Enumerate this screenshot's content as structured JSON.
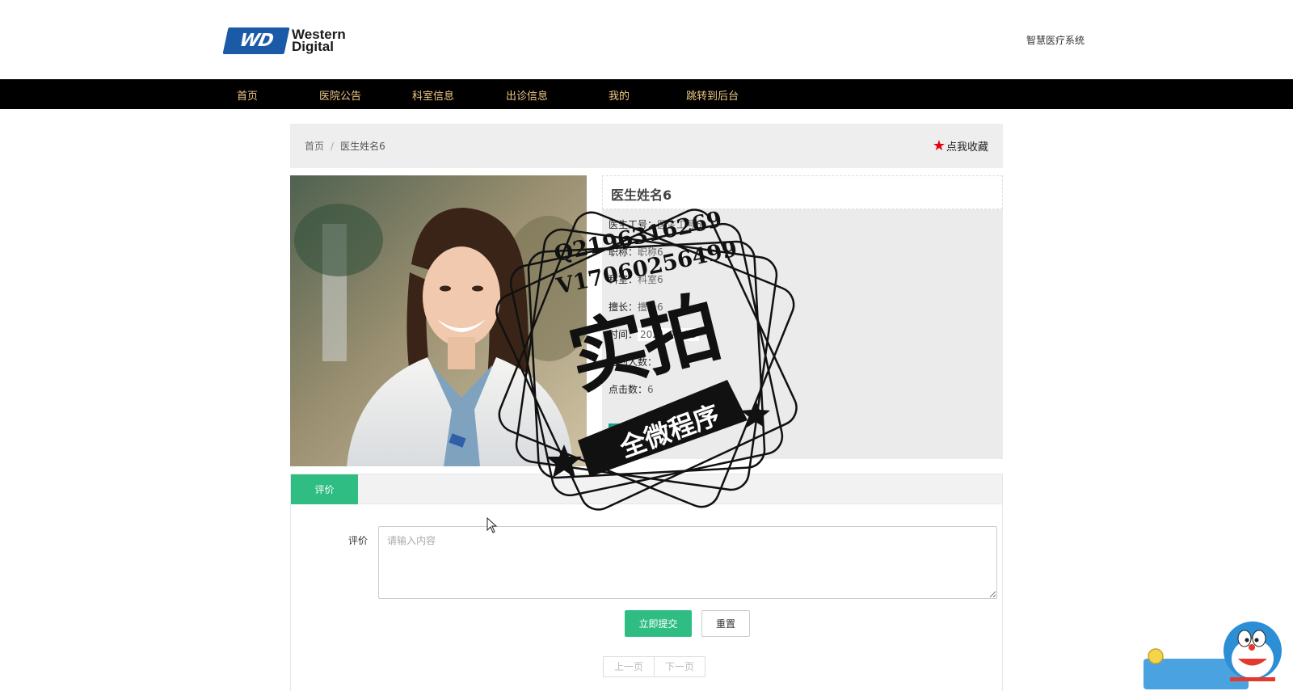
{
  "header": {
    "logo_mark": "WD",
    "logo_line1": "Western",
    "logo_line2": "Digital",
    "site_name": "智慧医疗系统"
  },
  "nav": {
    "items": [
      "首页",
      "医院公告",
      "科室信息",
      "出诊信息",
      "我的",
      "跳转到后台"
    ]
  },
  "breadcrumb": {
    "home": "首页",
    "separator": "/",
    "current": "医生姓名6"
  },
  "favorite": {
    "label": "点我收藏",
    "icon": "star-icon",
    "color": "#e60012"
  },
  "doctor": {
    "name": "医生姓名6",
    "fields": [
      {
        "label": "医生工号：",
        "value": "医生工号6"
      },
      {
        "label": "职称：",
        "value": "职称6"
      },
      {
        "label": "科室：",
        "value": "科室6"
      },
      {
        "label": "擅长：",
        "value": "擅长6"
      },
      {
        "label": "时间：",
        "value": "2021-03-08"
      },
      {
        "label": "可约人数：",
        "value": ""
      },
      {
        "label": "点击数：",
        "value": "6"
      }
    ]
  },
  "review": {
    "tab_label": "评价",
    "field_label": "评价",
    "placeholder": "请输入内容",
    "submit_label": "立即提交",
    "reset_label": "重置",
    "prev_label": "上一页",
    "next_label": "下一页"
  },
  "watermark": {
    "line1": "Q2196316269",
    "line2": "V17060256499",
    "big": "实拍",
    "ribbon": "全微程序"
  },
  "colors": {
    "nav_bg": "#000000",
    "nav_text": "#f0c987",
    "accent_green": "#2fbd84",
    "brand_blue": "#1b5aa6"
  }
}
